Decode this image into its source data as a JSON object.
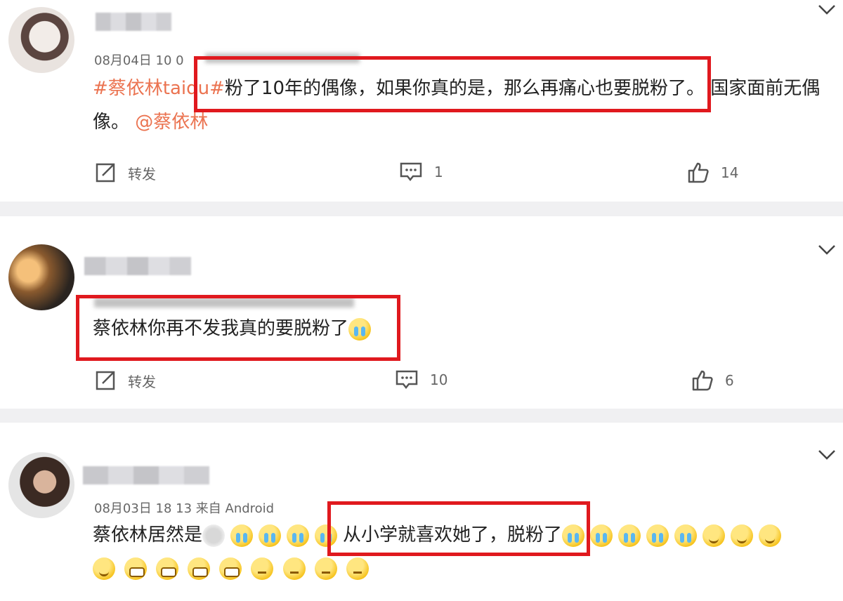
{
  "posts": [
    {
      "date": "08月04日 10 0",
      "text_hashtag": "#蔡依林taidu#",
      "text_highlight": "粉了10年的偶像，如果你真的是，那么再痛心也要脱粉了。",
      "text_rest_line1": "国家面前无偶",
      "text_line2": "像。",
      "mention": "@蔡依林",
      "repost_label": "转发",
      "comment_count": "1",
      "like_count": "14"
    },
    {
      "text_highlight": "蔡依林你再不发我真的要脱粉了",
      "repost_label": "转发",
      "comment_count": "10",
      "like_count": "6"
    },
    {
      "meta": "08月03日 18 13  来自 Android",
      "text_prefix": "蔡依林居然是",
      "text_highlight": "从小学就喜欢她了，脱粉了"
    }
  ],
  "icons": [
    "repost-icon",
    "comment-icon",
    "like-icon",
    "chevron-down-icon"
  ],
  "colors": {
    "highlight_box": "#e0191e",
    "hashtag": "#eb7350",
    "separator": "#f0f0f2"
  }
}
